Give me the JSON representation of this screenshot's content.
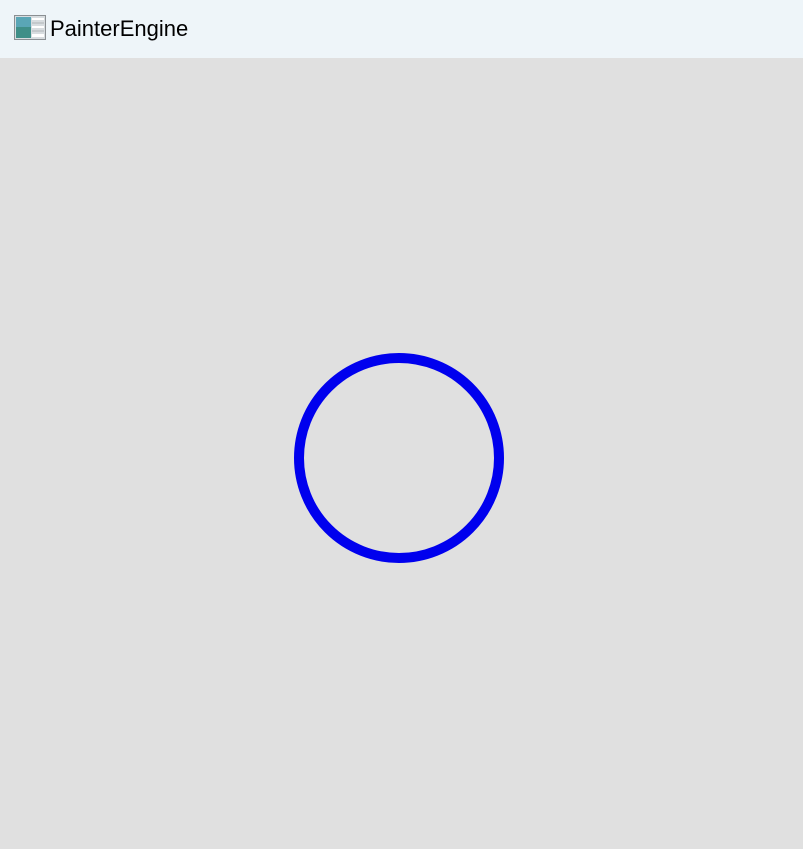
{
  "window": {
    "title": "PainterEngine",
    "icon": "painter-engine-app-icon"
  },
  "canvas": {
    "background_color": "#e0e0e0",
    "shape": {
      "type": "circle",
      "stroke_color": "#0000ee",
      "fill": "none"
    }
  }
}
